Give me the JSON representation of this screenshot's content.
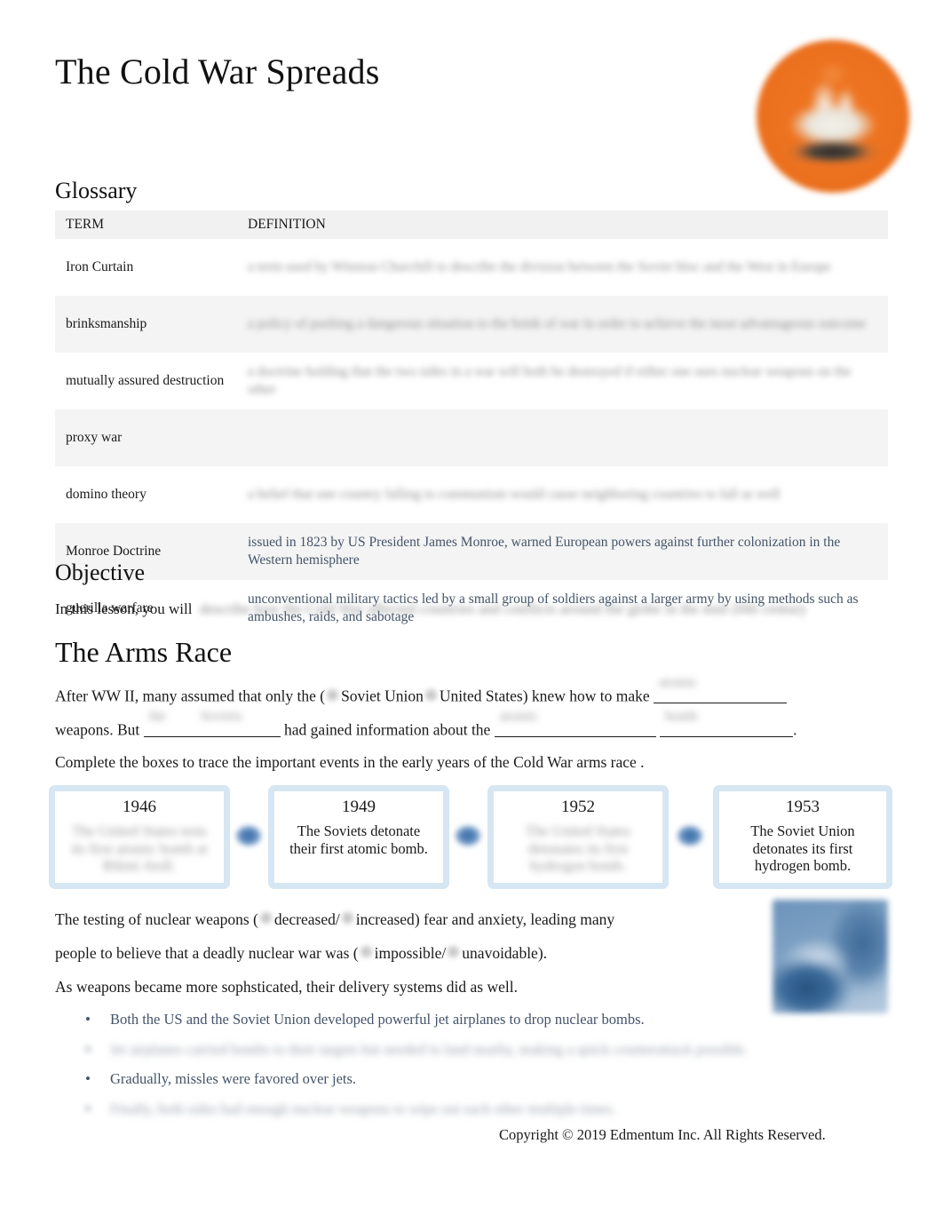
{
  "document": {
    "title": "The Cold War Spreads",
    "logo_icon": "edmentum-orange-circle-logo"
  },
  "glossary": {
    "heading": "Glossary",
    "columns": [
      "TERM",
      "DEFINITION"
    ],
    "rows": [
      {
        "term": "Iron Curtain",
        "definition": "",
        "redacted": true
      },
      {
        "term": "brinksmanship",
        "definition": "",
        "redacted": true
      },
      {
        "term": "mutually assured destruction",
        "definition": "",
        "redacted": true
      },
      {
        "term": "proxy war",
        "definition": "",
        "redacted": true
      },
      {
        "term": "domino theory",
        "definition": "",
        "redacted": true
      },
      {
        "term": "Monroe Doctrine",
        "definition": "issued in 1823 by US President James Monroe, warned European powers against further colonization in the Western hemisphere",
        "redacted": false
      },
      {
        "term": "guerilla warfare",
        "definition": "unconventional military tactics led by a small group of soldiers against a larger army by using methods such as ambushes, raids, and sabotage",
        "redacted": false
      }
    ]
  },
  "objective": {
    "heading": "Objective",
    "lead_in": "In this lesson, you will",
    "statement": "",
    "redacted": true
  },
  "arms_race": {
    "heading": "The Arms Race",
    "paragraph1": {
      "part1": "After WW II, many assumed that only the (",
      "option_a": "Soviet Union",
      "option_b": "United States",
      "part2": ") knew how to make",
      "answer1": "",
      "part3": "weapons. But",
      "answer2": "",
      "answer3": "",
      "part4": "had gained information about the",
      "answer4": "",
      "answer5": "",
      "end": "."
    },
    "instruction": "Complete the boxes to trace the important events in the early years of the Cold War arms race  .",
    "timeline": [
      {
        "year": "1946",
        "text": "",
        "redacted": true
      },
      {
        "year": "1949",
        "text": "The Soviets detonate their first atomic bomb.",
        "redacted": false
      },
      {
        "year": "1952",
        "text": "",
        "redacted": true
      },
      {
        "year": "1953",
        "text": "The Soviet Union detonates its first hydrogen bomb.",
        "redacted": false
      }
    ],
    "paragraph2": {
      "part1": "The testing of nuclear weapons (",
      "option_a": "decreased/",
      "option_b": "increased",
      "part2": ") fear and anxiety, leading many",
      "line2_part1": "people to believe that a deadly nuclear war was (",
      "line2_option_a": "impossible/",
      "line2_option_b": "unavoidable",
      "line2_part2": ")."
    },
    "paragraph3": "As weapons became more sophsticated, their delivery systems did as well.",
    "bullets": [
      {
        "text": "Both the US and the Soviet Union developed powerful jet airplanes to drop nuclear bombs.",
        "redacted": false
      },
      {
        "text": "",
        "redacted": true
      },
      {
        "text": "Gradually, missles were favored over jets.",
        "redacted": false
      },
      {
        "text": "",
        "redacted": true
      }
    ],
    "side_photo_icon": "nuclear-missile-photo"
  },
  "footer": {
    "copyright": "Copyright © 2019 Edmentum Inc. All Rights Reserved."
  },
  "colors": {
    "definition_text": "#44546a",
    "timeline_border": "#d6e6f2",
    "timeline_arrow": "#3b6fa8",
    "logo_orange": "#ed7220",
    "table_header_bg": "#f1f1f1",
    "table_alt_row_bg": "#f4f4f4"
  }
}
